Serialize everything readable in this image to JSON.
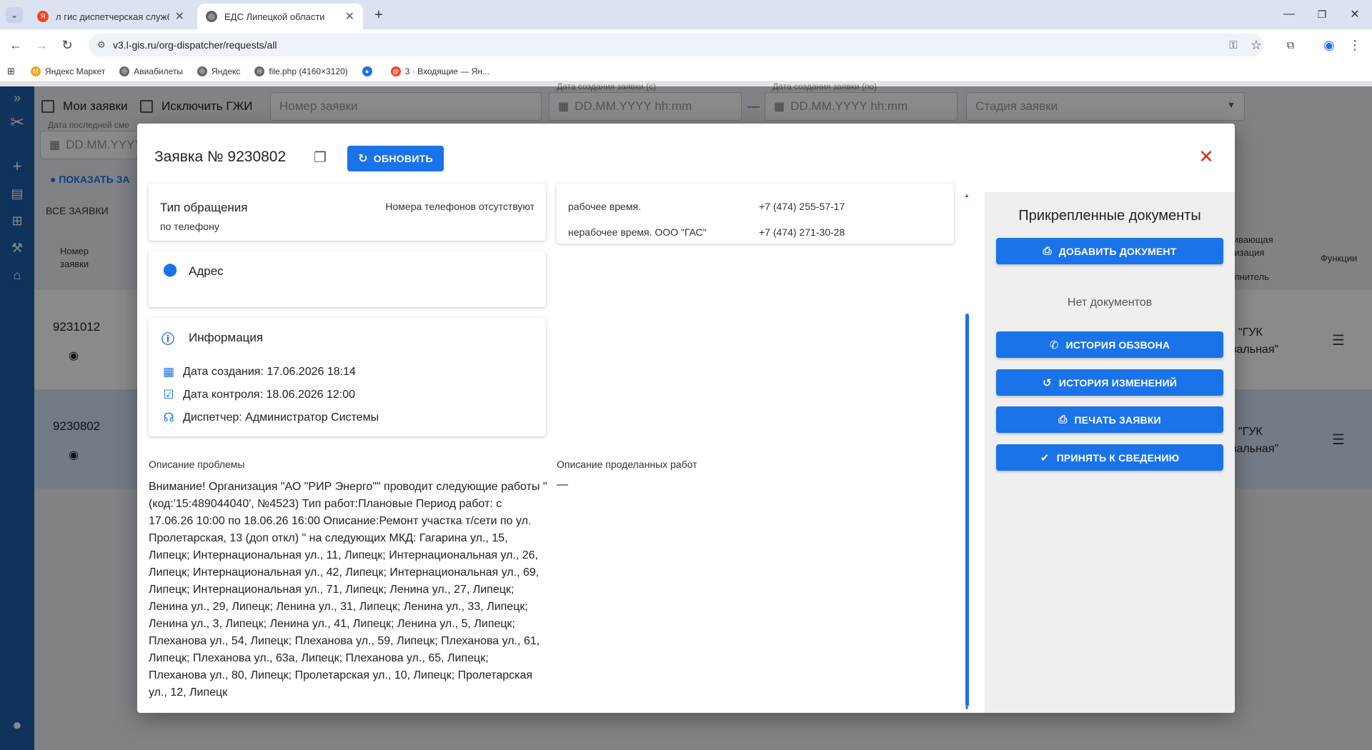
{
  "browser": {
    "tabs": [
      {
        "title": "л гис диспетчерская служба —",
        "favicon": "yandex-icon",
        "color": "#fc3f1d"
      },
      {
        "title": "ЕДС Липецкой области",
        "favicon": "globe-icon",
        "color": "#5f6368"
      }
    ],
    "url": "v3.l-gis.ru/org-dispatcher/requests/all",
    "bookmarks": [
      {
        "label": "Яндекс Маркет",
        "icon": "market-icon",
        "color": "#f5a623"
      },
      {
        "label": "Авиабилеты",
        "icon": "globe-icon",
        "color": "#666666"
      },
      {
        "label": "Яндекс",
        "icon": "globe-icon",
        "color": "#666666"
      },
      {
        "label": "file.php (4160×3120)",
        "icon": "globe-icon",
        "color": "#666666"
      },
      {
        "label": "",
        "icon": "blue-dot-icon",
        "color": "#1a73e8"
      },
      {
        "label": "3 · Входящие — Ян...",
        "icon": "mail-icon",
        "color": "#fc3f1d"
      }
    ]
  },
  "filters": {
    "my_requests": "Мои заявки",
    "exclude_gzhi": "Исключить ГЖИ",
    "number_placeholder": "Номер заявки",
    "date_from_label": "Дата создания заявки (с)",
    "date_to_label": "Дата создания заявки (по)",
    "date_placeholder": "DD.MM.YYYY hh:mm",
    "dash": "—",
    "stage_placeholder": "Стадия заявки",
    "last_change_label": "Дата последней сме",
    "last_change_placeholder": "DD.MM.YYYY",
    "show_map": "ПОКАЗАТЬ ЗА",
    "all_requests_tab": "ВСЕ ЗАЯВКИ"
  },
  "table": {
    "col_number": "Номер\nзаявки",
    "col_org_a": "кивающая\nнизация",
    "col_org_b": "олнитель",
    "col_functions": "Функции",
    "rows": [
      {
        "number": "9231012",
        "org": "О \"ГУК\nкзальная\""
      },
      {
        "number": "9230802",
        "org": "О \"ГУК\nкзальная\""
      }
    ]
  },
  "dialog": {
    "title": "Заявка № 9230802",
    "refresh_label": "ОБНОВИТЬ",
    "request_type": {
      "title": "Тип обращения",
      "value": "по телефону",
      "phones_note": "Номера телефонов отсутствуют"
    },
    "contacts": [
      {
        "label": "рабочее время.",
        "phone": "+7 (474) 255-57-17"
      },
      {
        "label": "нерабочее время. ООО \"ГАС\"",
        "phone": "+7 (474) 271-30-28"
      }
    ],
    "address": {
      "title": "Адрес"
    },
    "info": {
      "title": "Информация",
      "created": "Дата создания: 17.06.2026 18:14",
      "control": "Дата контроля: 18.06.2026 12:00",
      "dispatcher": "Диспетчер: Администратор Системы"
    },
    "problem": {
      "title": "Описание проблемы",
      "text": "Внимание! Организация \"АО \"РИР Энерго\"\" проводит следующие работы \"(код:'15:489044040', №4523) Тип работ:Плановые Период работ: с 17.06.26 10:00 по 18.06.26 16:00 Описание:Ремонт участка т/сети по ул. Пролетарская, 13 (доп откл) \" на следующих МКД: Гагарина ул., 15, Липецк; Интернациональная ул., 11, Липецк; Интернациональная ул., 26, Липецк; Интернациональная ул., 42, Липецк; Интернациональная ул., 69, Липецк; Интернациональная ул., 71, Липецк; Ленина ул., 27, Липецк; Ленина ул., 29, Липецк; Ленина ул., 31, Липецк; Ленина ул., 33, Липецк; Ленина ул., 3, Липецк; Ленина ул., 41, Липецк; Ленина ул., 5, Липецк; Плеханова ул., 54, Липецк; Плеханова ул., 59, Липецк; Плеханова ул., 61, Липецк; Плеханова ул., 63а, Липецк; Плеханова ул., 65, Липецк; Плеханова ул., 80, Липецк; Пролетарская ул., 10, Липецк; Пролетарская ул., 12, Липецк"
    },
    "work_done": {
      "title": "Описание проделанных работ",
      "value": "—"
    },
    "docs": {
      "title": "Прикрепленные документы",
      "add": "ДОБАВИТЬ ДОКУМЕНТ",
      "empty": "Нет документов",
      "call_history": "ИСТОРИЯ ОБЗВОНА",
      "change_history": "ИСТОРИЯ ИЗМЕНЕНИЙ",
      "print": "ПЕЧАТЬ ЗАЯВКИ",
      "accept": "ПРИНЯТЬ К СВЕДЕНИЮ"
    }
  },
  "colors": {
    "accent": "#1a73e8",
    "sidebar": "#1f5fa8",
    "close": "#d93025"
  }
}
